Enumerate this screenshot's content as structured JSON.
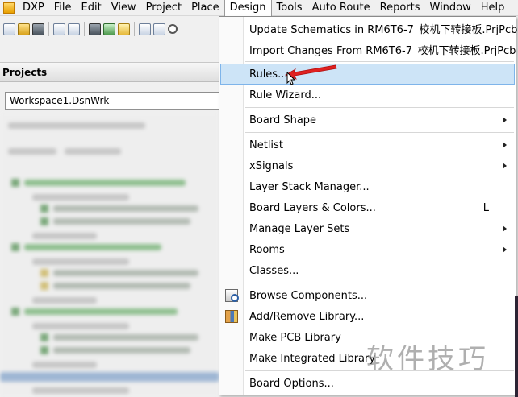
{
  "menubar": {
    "items": [
      {
        "label": "DXP"
      },
      {
        "label": "File"
      },
      {
        "label": "Edit"
      },
      {
        "label": "View"
      },
      {
        "label": "Project"
      },
      {
        "label": "Place"
      },
      {
        "label": "Design",
        "active": true
      },
      {
        "label": "Tools"
      },
      {
        "label": "Auto Route"
      },
      {
        "label": "Reports"
      },
      {
        "label": "Window"
      },
      {
        "label": "Help"
      }
    ]
  },
  "projects_panel": {
    "title": "Projects",
    "workspace": "Workspace1.DsnWrk"
  },
  "design_menu": {
    "items": [
      {
        "label": "Update Schematics in RM6T6-7_校机下转接板.PrjPcb"
      },
      {
        "label": "Import Changes From RM6T6-7_校机下转接板.PrjPcb"
      },
      {
        "label": "Rules...",
        "highlighted": true
      },
      {
        "label": "Rule Wizard..."
      },
      {
        "label": "Board Shape",
        "submenu": true
      },
      {
        "label": "Netlist",
        "submenu": true
      },
      {
        "label": "xSignals",
        "submenu": true
      },
      {
        "label": "Layer Stack Manager..."
      },
      {
        "label": "Board Layers & Colors...",
        "shortcut": "L"
      },
      {
        "label": "Manage Layer Sets",
        "submenu": true
      },
      {
        "label": "Rooms",
        "submenu": true
      },
      {
        "label": "Classes..."
      },
      {
        "label": "Browse Components...",
        "icon": "browse-components-icon"
      },
      {
        "label": "Add/Remove Library...",
        "icon": "library-icon"
      },
      {
        "label": "Make PCB Library"
      },
      {
        "label": "Make Integrated Library"
      },
      {
        "label": "Board Options..."
      }
    ]
  },
  "watermark": "软件技巧",
  "colors": {
    "menu_highlight": "#cde4f7",
    "menu_highlight_border": "#7eb4ea",
    "annotation_arrow": "#e02020"
  }
}
